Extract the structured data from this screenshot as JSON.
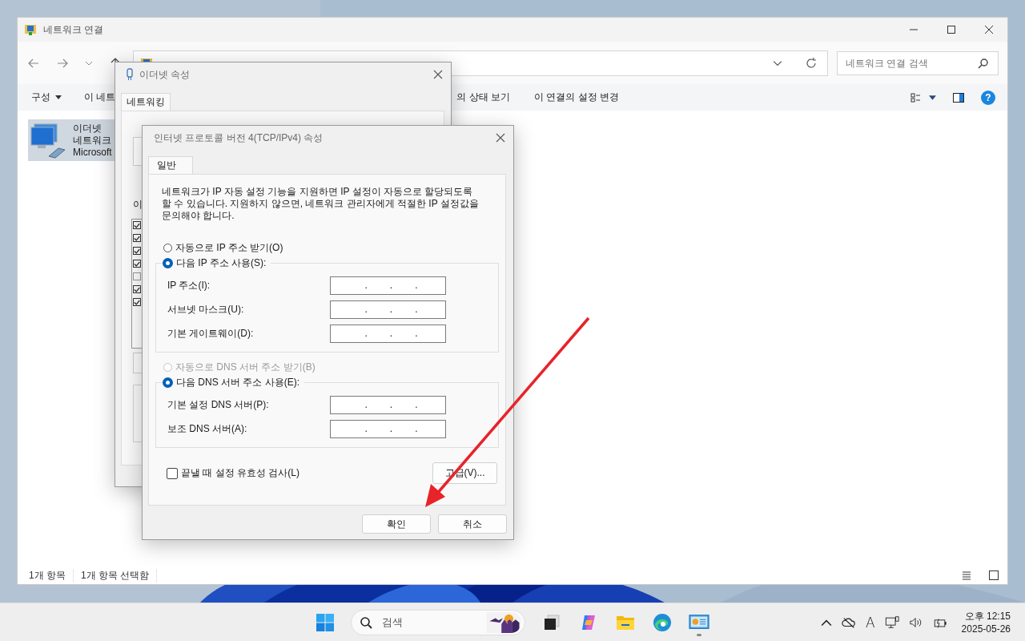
{
  "explorer": {
    "title": "네트워크 연결",
    "search": {
      "placeholder": "네트워크 연결 검색"
    },
    "help": "?",
    "toolbar": [
      {
        "label": "구성",
        "dropdown": true
      },
      {
        "label": "이 네트",
        "dropdown": false
      },
      {
        "label": "의 상태 보기",
        "dropdown": false
      },
      {
        "label": "이 연결의 설정 변경",
        "dropdown": false
      }
    ],
    "items": [
      {
        "lines": [
          "이더넷",
          "네트워크",
          "Microsoft"
        ],
        "selected": true
      }
    ],
    "status_bar": [
      "1개 항목",
      "1개 항목 선택함"
    ]
  },
  "ethernet_dialog": {
    "title": "이더넷 속성",
    "tabs": [
      {
        "label": "네트워킹",
        "selected": true
      }
    ],
    "items_label": "이",
    "components": [
      {
        "checked": true
      },
      {
        "checked": true
      },
      {
        "checked": true
      },
      {
        "checked": true
      },
      {
        "checked": false
      },
      {
        "checked": true
      },
      {
        "checked": true
      }
    ]
  },
  "ipv4_dialog": {
    "title": "인터넷 프로토콜 버전 4(TCP/IPv4) 속성",
    "tabs": [
      {
        "label": "일반",
        "selected": true
      }
    ],
    "description": "네트워크가 IP 자동 설정 기능을 지원하면 IP 설정이 자동으로 할당되도록 할 수 있습니다. 지원하지 않으면, 네트워크 관리자에게 적절한 IP 설정값을 문의해야 합니다.",
    "separator": ".",
    "ip_auto": {
      "label": "자동으로 IP 주소 받기(O)",
      "selected": false,
      "disabled": false
    },
    "ip_manual": {
      "label": "다음 IP 주소 사용(S):",
      "selected": true,
      "disabled": false
    },
    "ip_fields": [
      {
        "label": "IP 주소(I):"
      },
      {
        "label": "서브넷 마스크(U):"
      },
      {
        "label": "기본 게이트웨이(D):"
      }
    ],
    "dns_auto": {
      "label": "자동으로 DNS 서버 주소 받기(B)",
      "selected": false,
      "disabled": true
    },
    "dns_manual": {
      "label": "다음 DNS 서버 주소 사용(E):",
      "selected": true,
      "disabled": false
    },
    "dns_fields": [
      {
        "label": "기본 설정 DNS 서버(P):"
      },
      {
        "label": "보조 DNS 서버(A):"
      }
    ],
    "validate": {
      "label": "끝낼 때 설정 유효성 검사(L)",
      "checked": false
    },
    "advanced_button": "고급(V)...",
    "buttons": [
      "확인",
      "취소"
    ]
  },
  "taskbar": {
    "search_placeholder": "검색",
    "apps": [
      {
        "kind": "taskview",
        "active": false
      },
      {
        "kind": "copilot",
        "active": false
      },
      {
        "kind": "folder",
        "active": false
      },
      {
        "kind": "edge",
        "active": false
      },
      {
        "kind": "control",
        "active": true
      }
    ],
    "ime": "A",
    "time": "오후 12:15",
    "date": "2025-05-26"
  }
}
